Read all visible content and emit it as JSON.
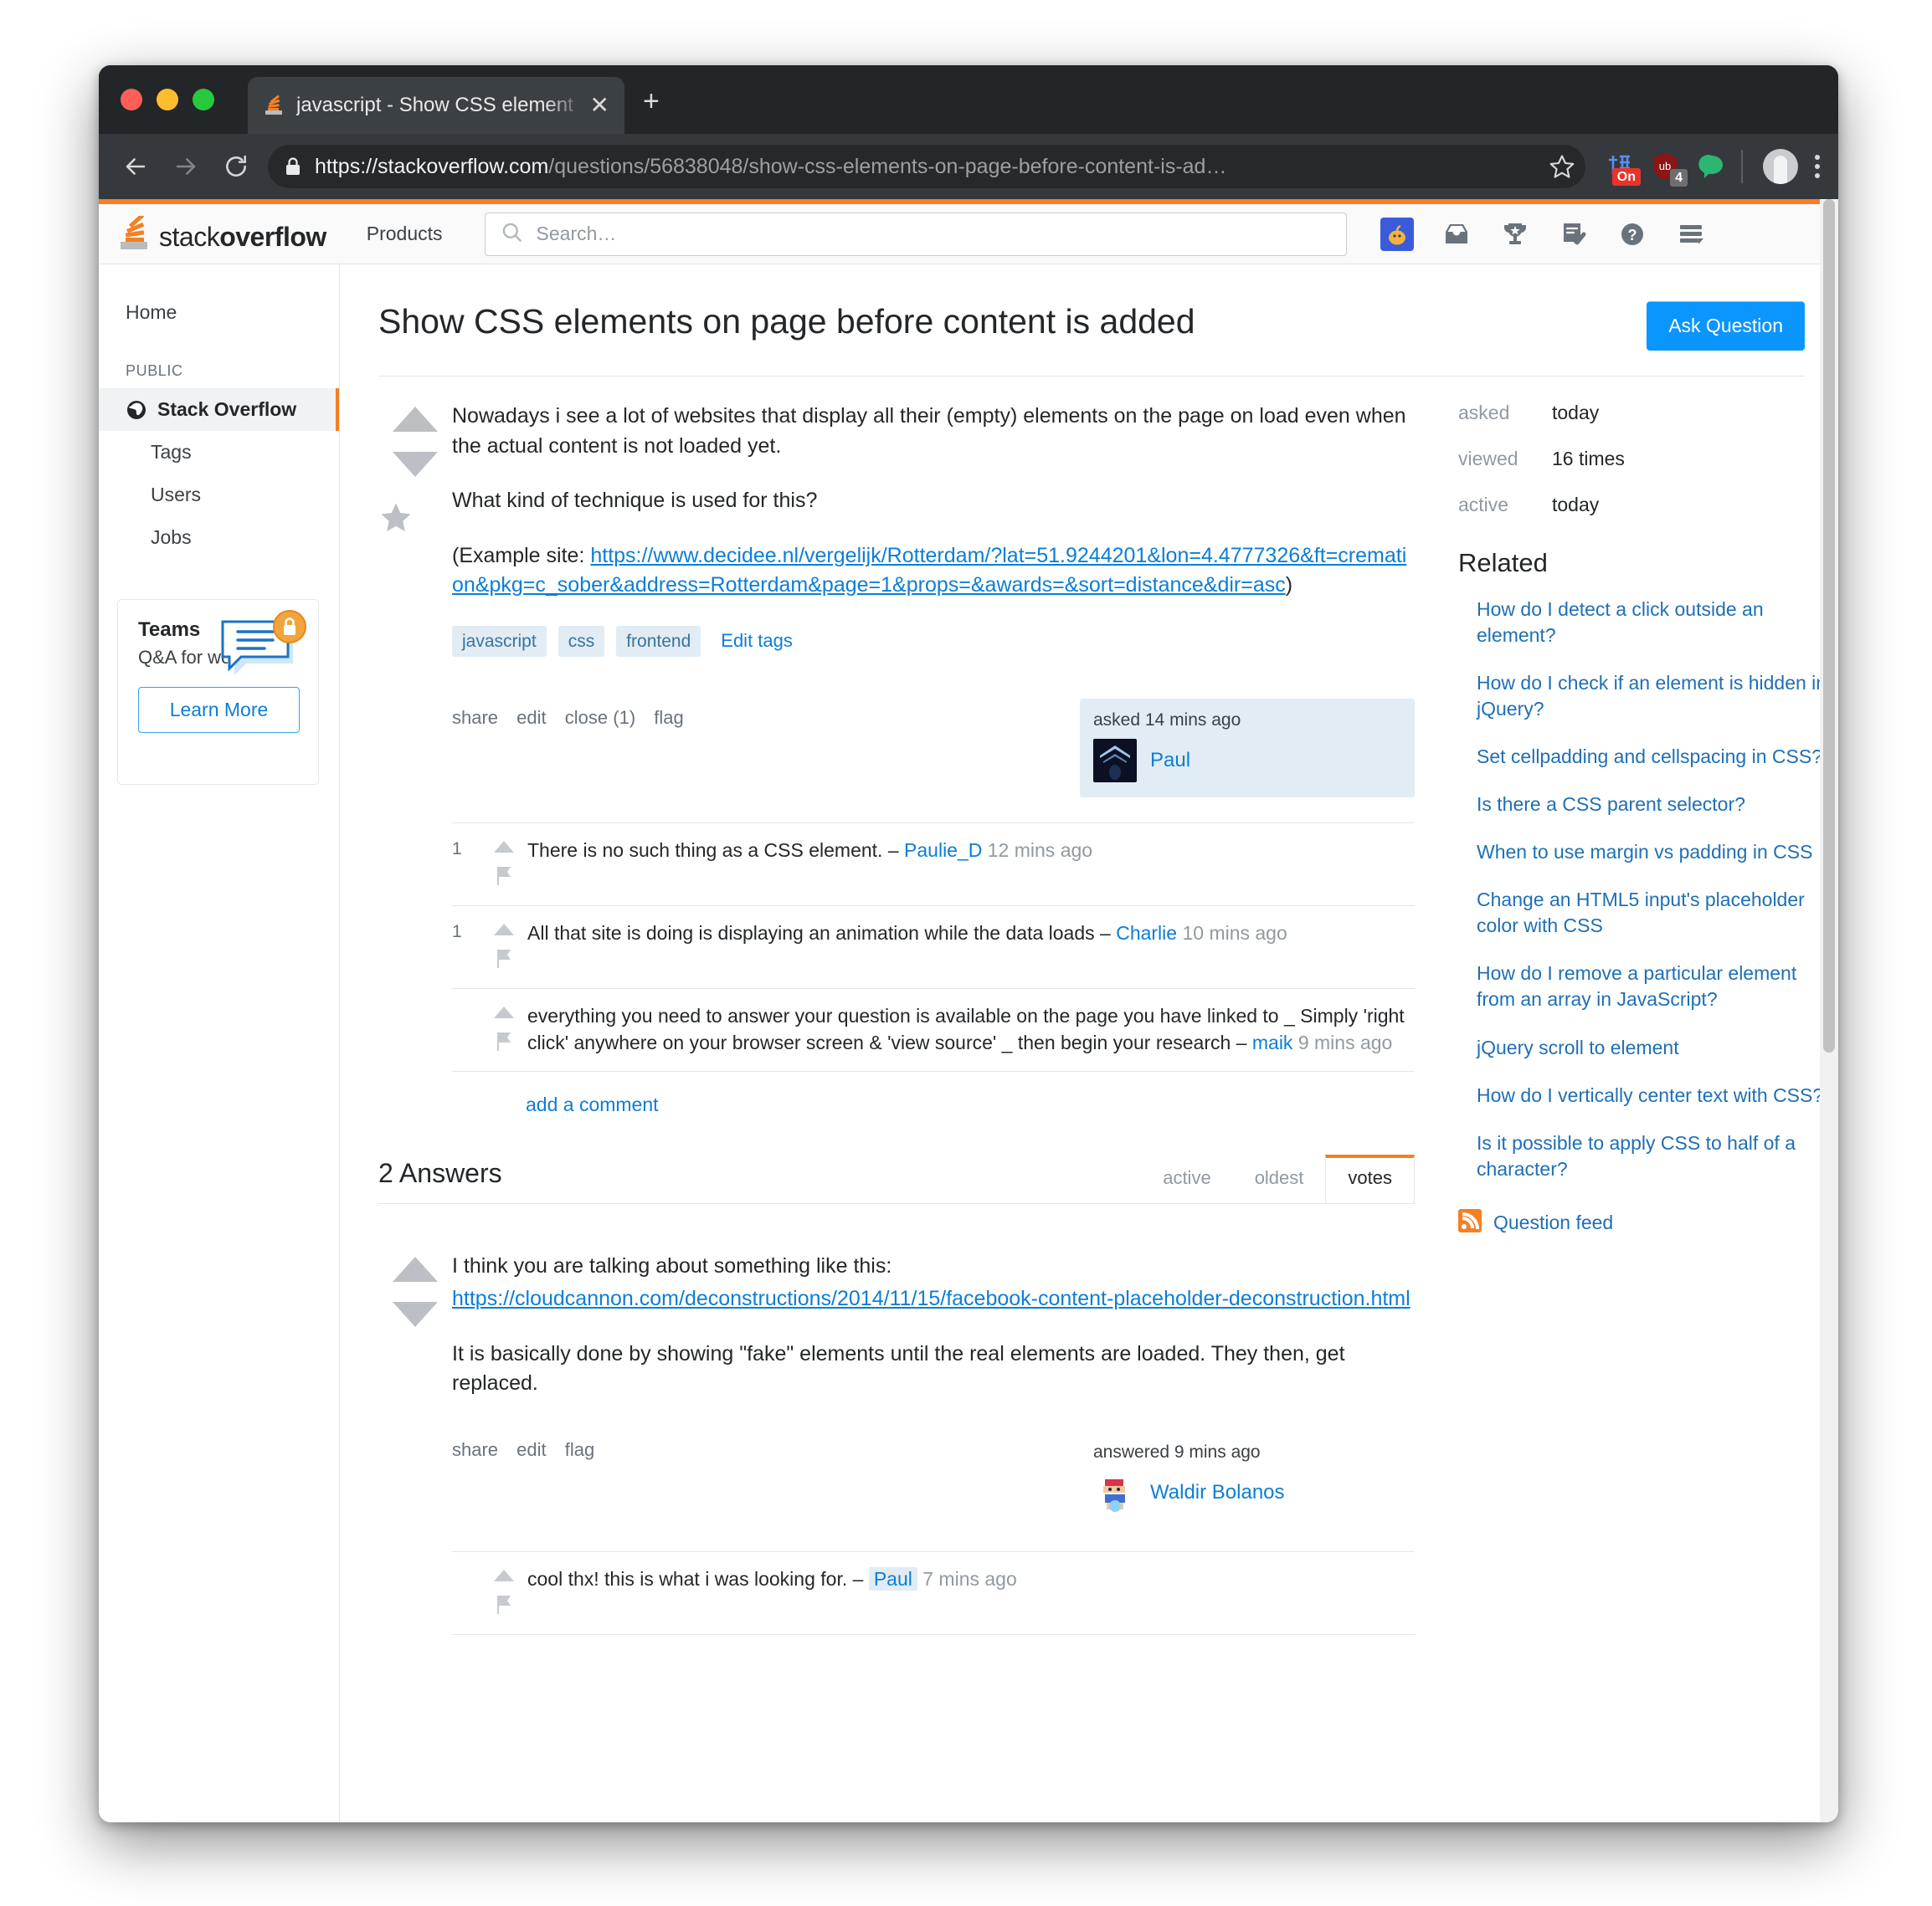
{
  "browser": {
    "tab_title": "javascript - Show CSS element",
    "tab_close_label": "✕",
    "new_tab_label": "+",
    "url_secure_part": "https://stackoverflow.com",
    "url_path_part": "/questions/56838048/show-css-elements-on-page-before-content-is-ad…",
    "extensions": [
      {
        "name": "grammar-extension",
        "badge": "On",
        "badge_color": "#e8342a"
      },
      {
        "name": "ublock-origin-extension",
        "badge": "4",
        "badge_color": "#6e6e6e"
      },
      {
        "name": "green-bubble-extension",
        "badge": "",
        "badge_color": ""
      }
    ]
  },
  "site_header": {
    "logo_text_light": "stack",
    "logo_text_bold": "overflow",
    "products": "Products",
    "search_placeholder": "Search…",
    "icons": [
      "user-avatar-tile",
      "inbox-icon",
      "trophy-icon",
      "review-icon",
      "help-icon",
      "site-switcher-icon"
    ]
  },
  "sidebar": {
    "home": "Home",
    "section_label": "PUBLIC",
    "items": [
      {
        "label": "Stack Overflow",
        "active": true
      },
      {
        "label": "Tags",
        "active": false
      },
      {
        "label": "Users",
        "active": false
      },
      {
        "label": "Jobs",
        "active": false
      }
    ],
    "teams": {
      "title": "Teams",
      "subtitle": "Q&A for work",
      "cta": "Learn More"
    }
  },
  "question": {
    "title": "Show CSS elements on page before content is added",
    "ask_button": "Ask Question",
    "body_p1": "Nowadays i see a lot of websites that display all their (empty) elements on the page on load even when the actual content is not loaded yet.",
    "body_p2": "What kind of technique is used for this?",
    "body_p3_prefix": "(Example site: ",
    "body_p3_link": "https://www.decidee.nl/vergelijk/Rotterdam/?lat=51.9244201&lon=4.4777326&ft=cremation&pkg=c_sober&address=Rotterdam&page=1&props=&awards=&sort=distance&dir=asc",
    "body_p3_suffix": ")",
    "tags": [
      "javascript",
      "css",
      "frontend"
    ],
    "edit_tags": "Edit tags",
    "actions": [
      "share",
      "edit",
      "close (1)",
      "flag"
    ],
    "owner_when": "asked 14 mins ago",
    "owner_name": "Paul",
    "add_comment": "add a comment",
    "comments": [
      {
        "score": "1",
        "text": "There is no such thing as a CSS element. – ",
        "user": "Paulie_D",
        "time": " 12 mins ago"
      },
      {
        "score": "1",
        "text": "All that site is doing is displaying an animation while the data loads – ",
        "user": "Charlie",
        "time": " 10 mins ago"
      },
      {
        "score": "",
        "text": "everything you need to answer your question is available on the page you have linked to _ Simply 'right click' anywhere on your browser screen & 'view source' _ then begin your research – ",
        "user": "maik",
        "time": " 9 mins ago"
      }
    ]
  },
  "answers": {
    "heading": "2 Answers",
    "sort_tabs": [
      {
        "label": "active",
        "active": false
      },
      {
        "label": "oldest",
        "active": false
      },
      {
        "label": "votes",
        "active": true
      }
    ],
    "first": {
      "body_p1": "I think you are talking about something like this:",
      "body_link": "https://cloudcannon.com/deconstructions/2014/11/15/facebook-content-placeholder-deconstruction.html",
      "body_p2": "It is basically done by showing \"fake\" elements until the real elements are loaded. They then, get replaced.",
      "actions": [
        "share",
        "edit",
        "flag"
      ],
      "owner_when": "answered 9 mins ago",
      "owner_name": "Waldir Bolanos",
      "comments": [
        {
          "score": "",
          "text": "cool thx! this is what i was looking for. – ",
          "user": "Paul",
          "time": " 7 mins ago"
        }
      ]
    }
  },
  "right_rail": {
    "stats": [
      {
        "label": "asked",
        "value": "today"
      },
      {
        "label": "viewed",
        "value": "16 times"
      },
      {
        "label": "active",
        "value": "today"
      }
    ],
    "related_title": "Related",
    "related": [
      "How do I detect a click outside an element?",
      "How do I check if an element is hidden in jQuery?",
      "Set cellpadding and cellspacing in CSS?",
      "Is there a CSS parent selector?",
      "When to use margin vs padding in CSS",
      "Change an HTML5 input's placeholder color with CSS",
      "How do I remove a particular element from an array in JavaScript?",
      "jQuery scroll to element",
      "How do I vertically center text with CSS?",
      "Is it possible to apply CSS to half of a character?"
    ],
    "question_feed": "Question feed"
  },
  "colors": {
    "accent_orange": "#f48024",
    "link_blue": "#0c7ed6",
    "ask_button_blue": "#0a95ff",
    "tag_bg": "#e1ecf4",
    "tag_fg": "#39739d"
  }
}
